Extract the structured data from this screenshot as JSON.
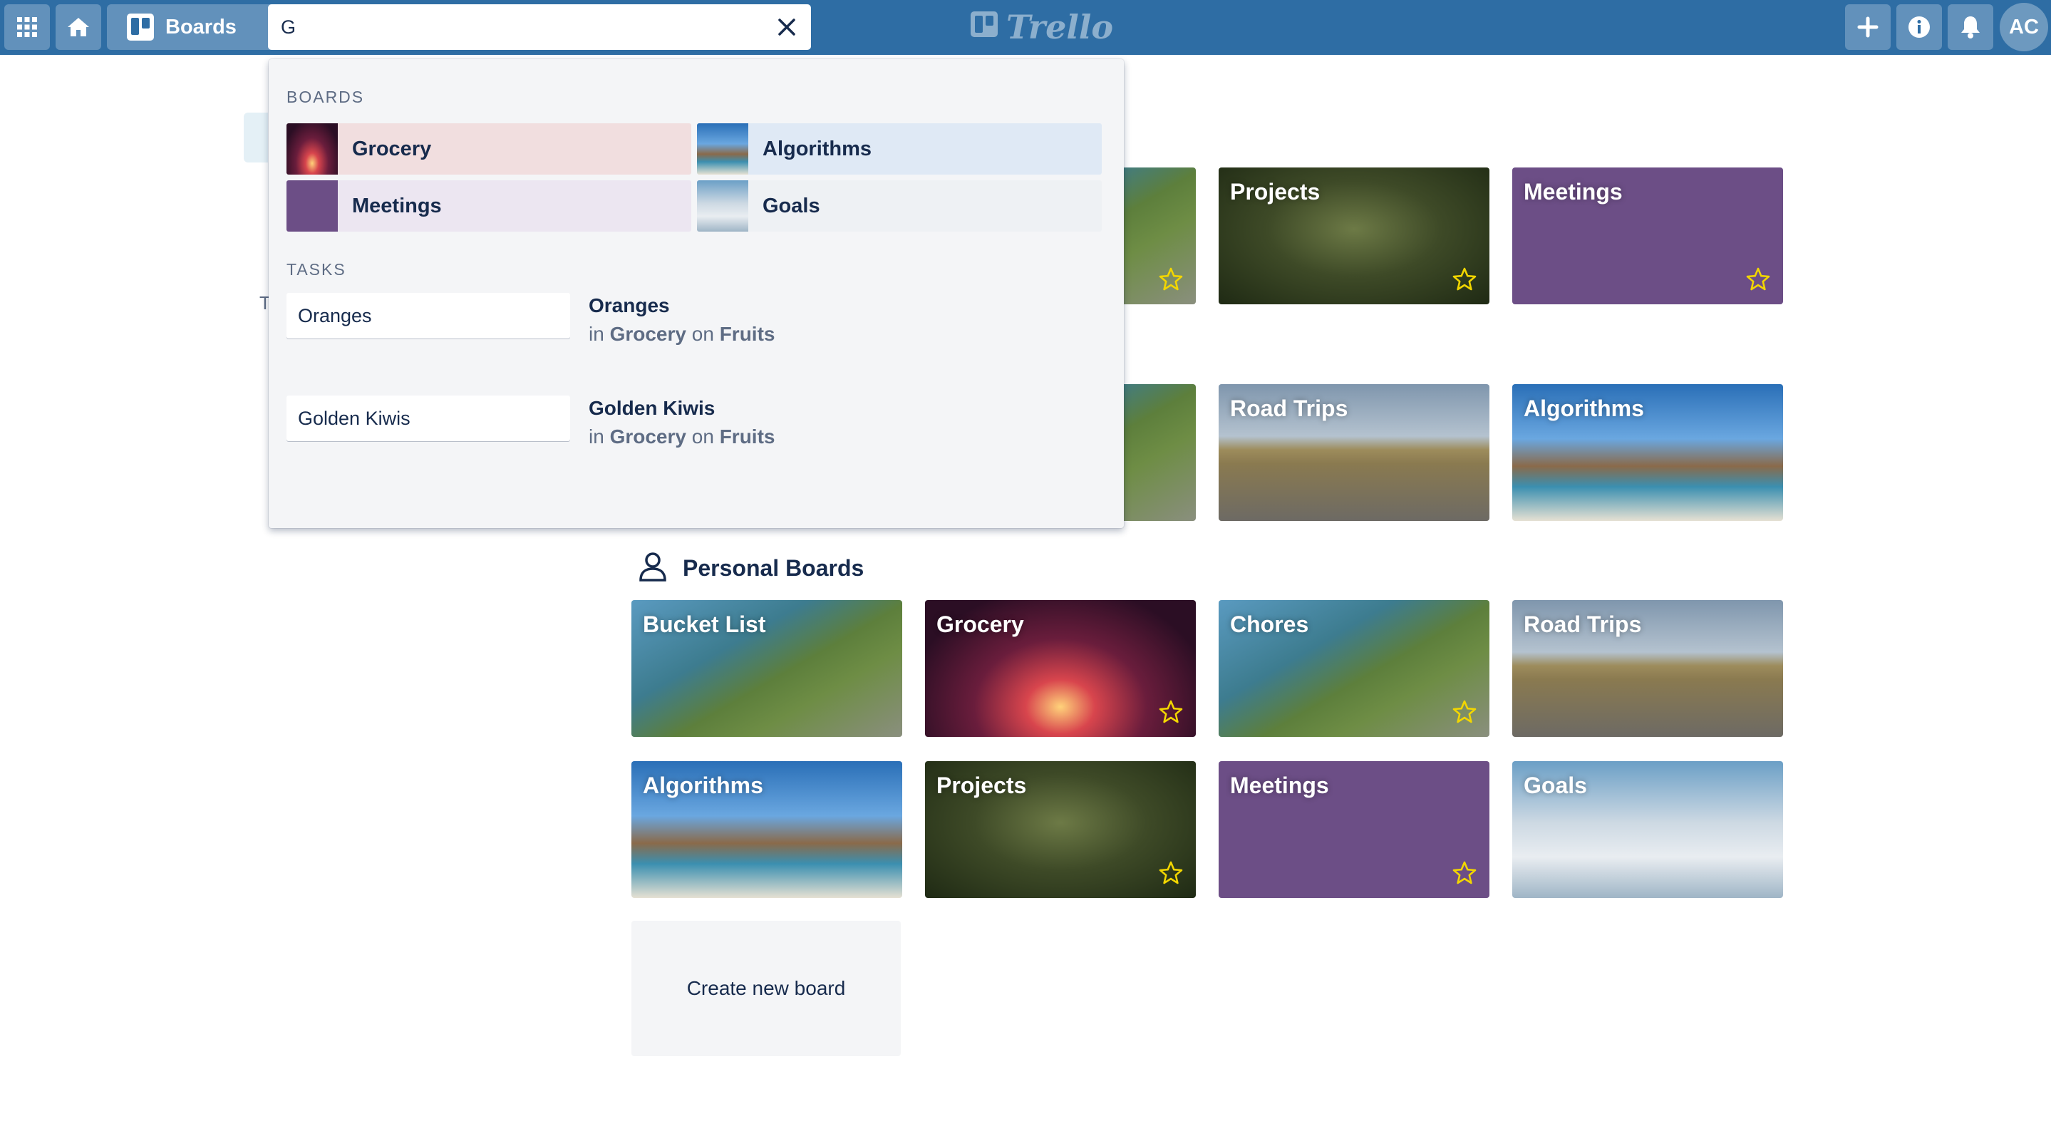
{
  "header": {
    "boards_label": "Boards",
    "search": {
      "value": "G",
      "placeholder": ""
    },
    "logo_text": "Trello",
    "avatar_initials": "AC",
    "icons": [
      "apps-grid-icon",
      "home-icon",
      "boards-icon",
      "close-icon",
      "plus-icon",
      "info-icon",
      "bell-icon"
    ]
  },
  "sidebar": {
    "fragment_label": "T"
  },
  "board_rows": [
    [
      {
        "title": "",
        "bg": "coast",
        "starred": true,
        "partial": true
      },
      {
        "title": "Projects",
        "bg": "forest",
        "starred": true
      },
      {
        "title": "Meetings",
        "bg": "purple",
        "starred": true
      }
    ],
    [
      {
        "title": "",
        "bg": "coast",
        "starred": false,
        "partial": true
      },
      {
        "title": "Road Trips",
        "bg": "road",
        "starred": false
      },
      {
        "title": "Algorithms",
        "bg": "beach",
        "starred": false
      }
    ]
  ],
  "personal": {
    "title": "Personal Boards",
    "boards": [
      {
        "title": "Bucket List",
        "bg": "coast",
        "starred": false
      },
      {
        "title": "Grocery",
        "bg": "sunset",
        "starred": true
      },
      {
        "title": "Chores",
        "bg": "coast",
        "starred": true
      },
      {
        "title": "Road Trips",
        "bg": "road",
        "starred": false
      },
      {
        "title": "Algorithms",
        "bg": "beach",
        "starred": false
      },
      {
        "title": "Projects",
        "bg": "forest",
        "starred": true
      },
      {
        "title": "Meetings",
        "bg": "purple",
        "starred": true
      },
      {
        "title": "Goals",
        "bg": "flag",
        "starred": false
      }
    ],
    "create_label": "Create new board"
  },
  "search_results": {
    "boards_label": "BOARDS",
    "boards": [
      {
        "name": "Grocery",
        "bg": "sunset",
        "tint": "#f1dedf"
      },
      {
        "name": "Algorithms",
        "bg": "beach",
        "tint": "#dfe9f5"
      },
      {
        "name": "Meetings",
        "bg": "purple",
        "tint": "#ece6f1"
      },
      {
        "name": "Goals",
        "bg": "flag",
        "tint": "#eef1f4"
      }
    ],
    "tasks_label": "TASKS",
    "tasks": [
      {
        "card_text": "Oranges",
        "name": "Oranges",
        "in_word": "in",
        "board": "Grocery",
        "on_word": "on",
        "list": "Fruits"
      },
      {
        "card_text": "Golden Kiwis",
        "name": "Golden Kiwis",
        "in_word": "in",
        "board": "Grocery",
        "on_word": "on",
        "list": "Fruits"
      }
    ]
  },
  "colors": {
    "header": "#2e6da4",
    "purple": "#6c4e86",
    "star": "#f2d600",
    "text": "#172b4d",
    "muted": "#5e6c84",
    "dropdown_bg": "#f4f5f7"
  }
}
